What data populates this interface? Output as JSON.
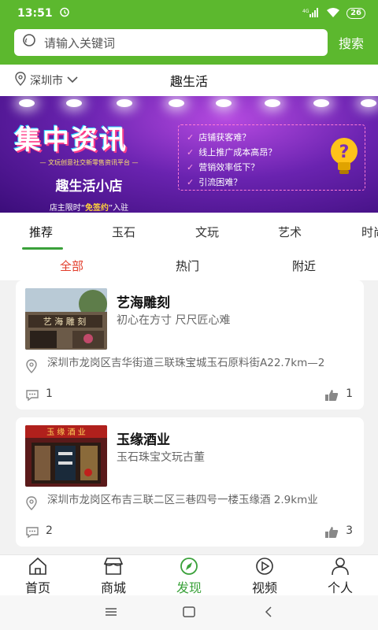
{
  "status": {
    "time": "13:51",
    "network": "4G",
    "battery": "26"
  },
  "search": {
    "placeholder": "请输入关键词",
    "button": "搜索"
  },
  "location": {
    "city": "深圳市",
    "title": "趣生活"
  },
  "banner": {
    "title": "集中资讯",
    "subtitle": "— 文玩创意社交新零售资讯平台 —",
    "shop_name": "趣生活小店",
    "join_prefix": "店主限时“",
    "join_highlight": "免签约",
    "join_suffix": "”入驻",
    "questions": [
      "店铺获客难？",
      "线上推广成本高昂？",
      "营销效率低下？",
      "引流困难？"
    ]
  },
  "categories": [
    "推荐",
    "玉石",
    "文玩",
    "艺术",
    "时尚"
  ],
  "filters": [
    "全部",
    "热门",
    "附近"
  ],
  "shops": [
    {
      "name": "艺海雕刻",
      "slogan": "初心在方寸 尺尺匠心难",
      "sign_text": "艺 海 雕 刻",
      "address": "深圳市龙岗区吉华街道三联珠宝城玉石原料街A22.7km—2",
      "comments": "1",
      "likes": "1"
    },
    {
      "name": "玉缘酒业",
      "slogan": "玉石珠宝文玩古董",
      "sign_text": "玉 缘 酒 业",
      "address": "深圳市龙岗区布吉三联二区三巷四号一楼玉缘酒 2.9km业",
      "comments": "2",
      "likes": "3"
    }
  ],
  "tabbar": [
    "首页",
    "商城",
    "发现",
    "视频",
    "个人"
  ],
  "colors": {
    "brand": "#5cb82e",
    "active_tab": "#3aa13a",
    "active_filter": "#e23d2b"
  }
}
